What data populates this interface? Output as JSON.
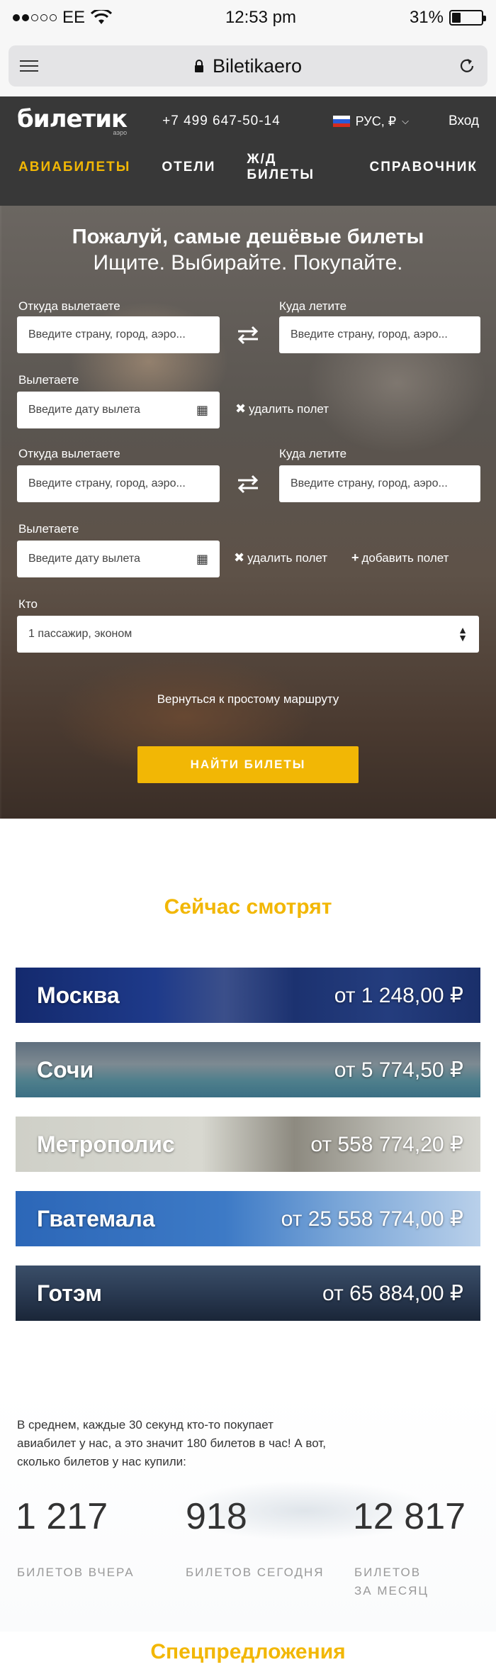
{
  "status": {
    "carrier": "EE",
    "time": "12:53 pm",
    "battery": "31%",
    "battery_level": 0.31
  },
  "browser": {
    "url": "Biletikaero"
  },
  "header": {
    "logo": "билетик",
    "logo_sub": "аэро",
    "phone": "+7 499 647-50-14",
    "lang": "РУС, ₽",
    "login": "Вход"
  },
  "nav": [
    "АВИАБИЛЕТЫ",
    "ОТЕЛИ",
    "Ж/Д БИЛЕТЫ",
    "СПРАВОЧНИК"
  ],
  "hero": {
    "title": "Пожалуй, самые дешёвые билеты",
    "subtitle": "Ищите. Выбирайте. Покупайте.",
    "from_label": "Откуда вылетаете",
    "to_label": "Куда летите",
    "from_placeholder": "Введите страну, город, аэро...",
    "to_placeholder": "Введите страну, город, аэро...",
    "date_label": "Вылетаете",
    "date_placeholder": "Введите дату вылета",
    "remove_flight": "удалить полет",
    "add_flight": "добавить полет",
    "who_label": "Кто",
    "who_value": "1 пассажир, эконом",
    "back_link": "Вернуться к простому маршруту",
    "search_button": "НАЙТИ БИЛЕТЫ"
  },
  "watching": {
    "title": "Сейчас смотрят",
    "items": [
      {
        "city": "Москва",
        "price": "от 1 248,00 ₽"
      },
      {
        "city": "Сочи",
        "price": "от 5 774,50 ₽"
      },
      {
        "city": "Метрополис",
        "price": "от 558 774,20 ₽"
      },
      {
        "city": "Гватемала",
        "price": "от 25 558 774,00 ₽"
      },
      {
        "city": "Готэм",
        "price": "от 65 884,00 ₽"
      }
    ]
  },
  "stats": {
    "text": "В среднем, каждые 30 секунд кто-то покупает авиабилет у нас, а это значит 180 билетов в час! А вот, сколько билетов у нас купили:",
    "items": [
      {
        "value": "1 217",
        "label": "БИЛЕТОВ ВЧЕРА"
      },
      {
        "value": "918",
        "label": "БИЛЕТОВ СЕГОДНЯ"
      },
      {
        "value": "12 817",
        "label": "БИЛЕТОВ ЗА МЕСЯЦ"
      }
    ]
  },
  "special": {
    "title": "Спецпредложения"
  },
  "colors": {
    "accent": "#f2b705",
    "header_bg": "#383838"
  }
}
